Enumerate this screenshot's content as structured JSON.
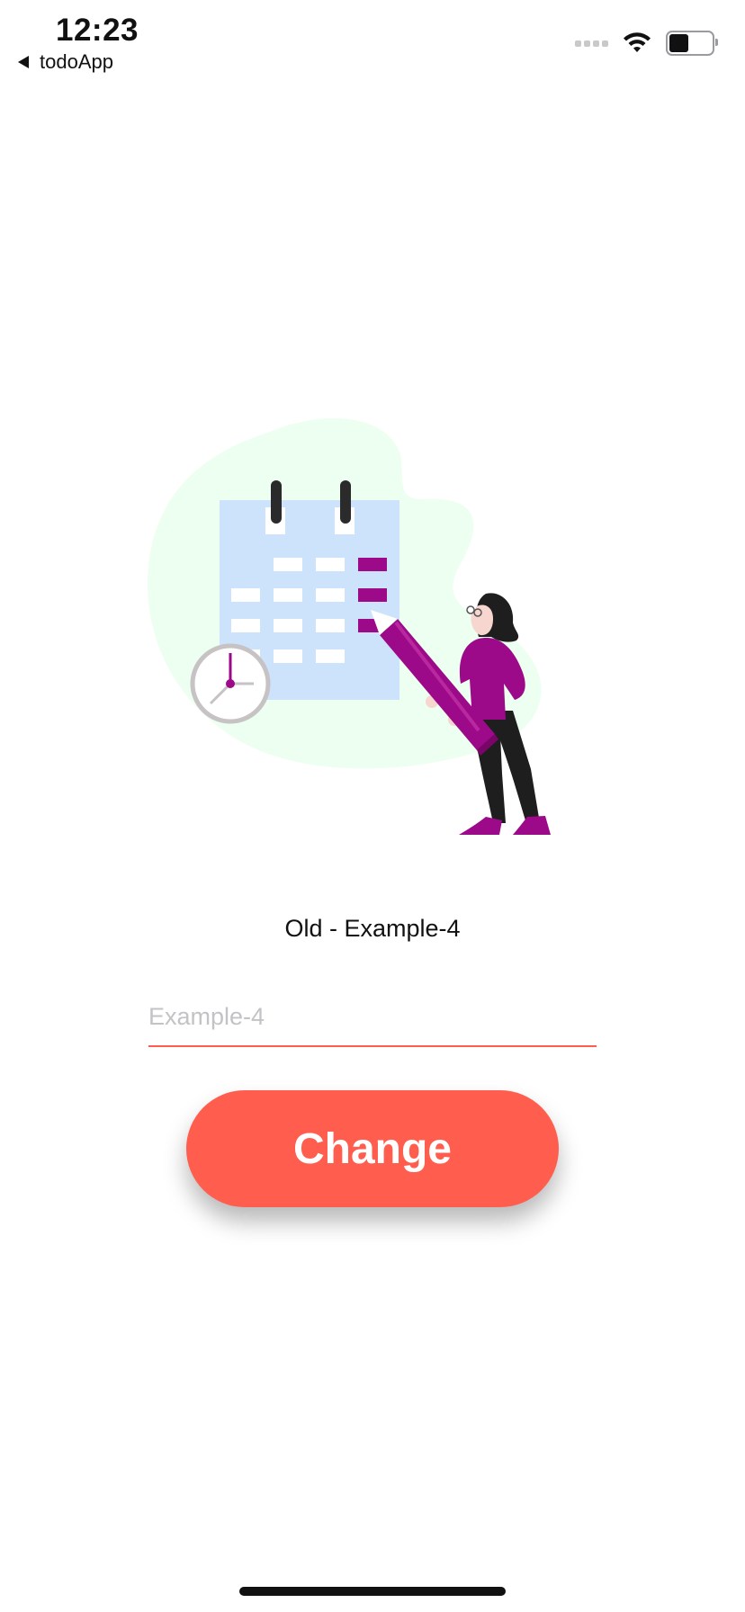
{
  "status_bar": {
    "time": "12:23",
    "back_app": "todoApp",
    "battery_level": 0.45,
    "icons": [
      "back-arrow-icon",
      "signal-icon",
      "wifi-icon",
      "battery-icon"
    ]
  },
  "illustration": {
    "name": "calendar-woman-pencil-illustration",
    "colors": {
      "blob": "#ecfff0",
      "calendar": "#cde2fb",
      "accent": "#9c0a8a",
      "dark": "#222222"
    }
  },
  "edit": {
    "old_label": "Old - Example-4",
    "input_value": "",
    "input_placeholder": "Example-4",
    "button_label": "Change"
  },
  "theme": {
    "primary": "#ff5e4f"
  }
}
